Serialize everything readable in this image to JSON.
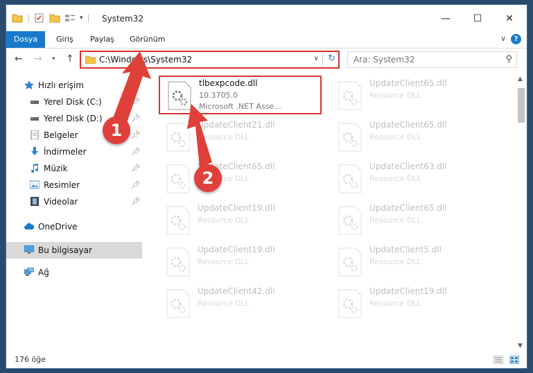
{
  "window": {
    "title": "System32",
    "controls": {
      "minimize": "—",
      "maximize": "☐",
      "close": "✕"
    }
  },
  "ribbon": {
    "tabs": [
      "Dosya",
      "Giriş",
      "Paylaş",
      "Görünüm"
    ],
    "help": "?"
  },
  "navigation": {
    "address_path": "C:\\Windows\\System32",
    "search_placeholder": "Ara: System32"
  },
  "sidebar": {
    "items": [
      {
        "label": "Hızlı erişim",
        "icon": "star-icon",
        "pinned": false
      },
      {
        "label": "Yerel Disk (C:)",
        "icon": "drive-icon",
        "pinned": true
      },
      {
        "label": "Yerel Disk (D:)",
        "icon": "drive-icon",
        "pinned": true
      },
      {
        "label": "Belgeler",
        "icon": "documents-icon",
        "pinned": true
      },
      {
        "label": "İndirmeler",
        "icon": "download-icon",
        "pinned": true
      },
      {
        "label": "Müzik",
        "icon": "music-icon",
        "pinned": true
      },
      {
        "label": "Resimler",
        "icon": "pictures-icon",
        "pinned": true
      },
      {
        "label": "Videolar",
        "icon": "video-icon",
        "pinned": true
      },
      {
        "label": "OneDrive",
        "icon": "cloud-icon",
        "pinned": false
      },
      {
        "label": "Bu bilgisayar",
        "icon": "computer-icon",
        "pinned": false,
        "selected": true
      },
      {
        "label": "Ağ",
        "icon": "network-icon",
        "pinned": false
      }
    ]
  },
  "files": {
    "highlighted": {
      "name": "tlbexpcode.dll",
      "version": "10.3705.0",
      "description": "Microsoft .NET Asse..."
    },
    "left_column": [
      {
        "name": "UpdateClient21.dll",
        "type": "Resource DLL"
      },
      {
        "name": "UpdateClient65.dll",
        "type": "Resource DLL"
      },
      {
        "name": "UpdateClient19.dll",
        "type": "Resource DLL"
      },
      {
        "name": "UpdateClient19.dll",
        "type": "Resource DLL"
      },
      {
        "name": "UpdateClient42.dll",
        "type": "Resource DLL"
      }
    ],
    "right_column": [
      {
        "name": "UpdateClient65.dll",
        "type": "Resource DLL"
      },
      {
        "name": "UpdateClient65.dll",
        "type": "Resource DLL"
      },
      {
        "name": "UpdateClient63.dll",
        "type": "Resource DLL"
      },
      {
        "name": "UpdateClient65.dll",
        "type": "Resource DLL"
      },
      {
        "name": "UpdateClient5.dll",
        "type": "Resource DLL"
      },
      {
        "name": "UpdateClient19.dll",
        "type": "Resource DLL"
      }
    ]
  },
  "status": {
    "item_count": "176 öğe"
  },
  "annotations": {
    "step1": "1",
    "step2": "2",
    "color": "#e0403a"
  },
  "colors": {
    "accent": "#1979ca",
    "highlight_border": "#d9322b"
  }
}
